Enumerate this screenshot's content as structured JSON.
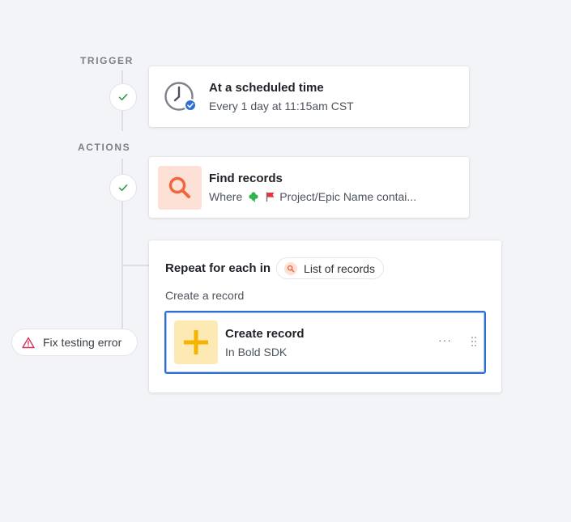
{
  "trigger_label": "TRIGGER",
  "actions_label": "ACTIONS",
  "trigger_step": {
    "title": "At a scheduled time",
    "subtitle": "Every 1 day at 11:15am CST",
    "icon": "clock-icon"
  },
  "find_step": {
    "title": "Find records",
    "subtitle_prefix": "Where",
    "subtitle_text": "Project/Epic Name contai...",
    "icon": "search-icon"
  },
  "repeat_block": {
    "title": "Repeat for each in",
    "pill_label": "List of records",
    "subhead": "Create a record",
    "inner_step": {
      "title": "Create record",
      "subtitle": "In Bold SDK",
      "icon": "plus-icon",
      "more_label": "···"
    }
  },
  "error_button": {
    "label": "Fix testing error",
    "icon": "warning-icon"
  },
  "colors": {
    "accent_blue": "#2f6fd4",
    "success_green": "#2f9e44",
    "search_orange": "#f0653a",
    "plus_yellow": "#f5b400",
    "error_red": "#d1335b"
  }
}
